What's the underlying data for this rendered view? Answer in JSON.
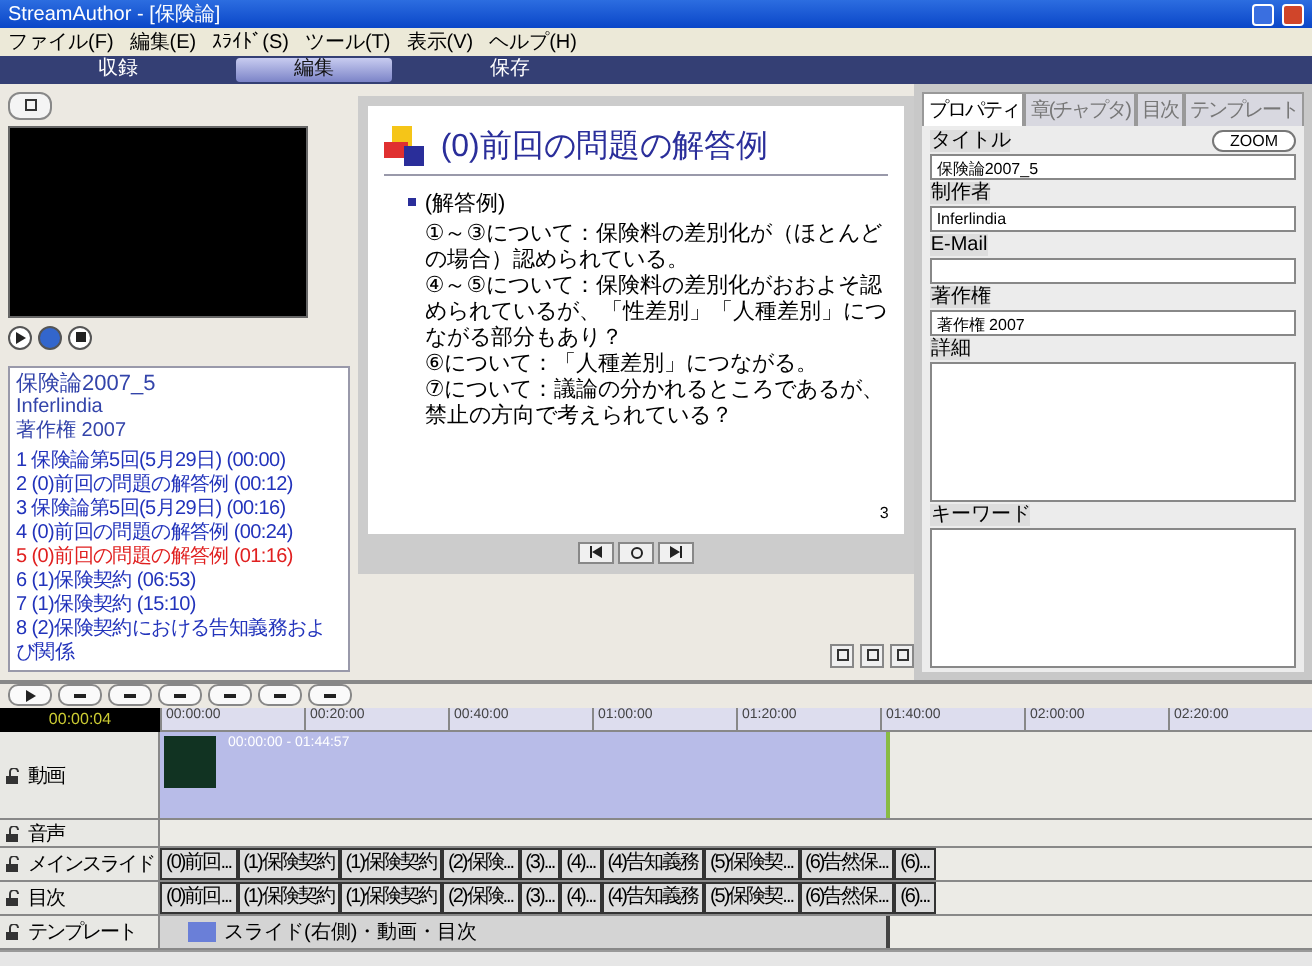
{
  "window": {
    "title": "StreamAuthor - [保険論]"
  },
  "menu": [
    "ファイル(F)",
    "編集(E)",
    "ｽﾗｲﾄﾞ(S)",
    "ツール(T)",
    "表示(V)",
    "ヘルプ(H)"
  ],
  "modes": [
    {
      "label": "収録",
      "selected": false
    },
    {
      "label": "編集",
      "selected": true
    },
    {
      "label": "保存",
      "selected": false
    }
  ],
  "contents": {
    "title": "保険論2007_5",
    "author": "Inferlindia",
    "copyright": "著作権 2007",
    "items": [
      {
        "label": "1 保険論第5回(5月29日) (00:00)",
        "selected": false
      },
      {
        "label": "2 (0)前回の問題の解答例 (00:12)",
        "selected": false
      },
      {
        "label": "3 保険論第5回(5月29日) (00:16)",
        "selected": false
      },
      {
        "label": "4 (0)前回の問題の解答例 (00:24)",
        "selected": false
      },
      {
        "label": "5 (0)前回の問題の解答例 (01:16)",
        "selected": true
      },
      {
        "label": "6 (1)保険契約 (06:53)",
        "selected": false
      },
      {
        "label": "7 (1)保険契約 (15:10)",
        "selected": false
      },
      {
        "label": "8 (2)保険契約における告知義務および関係",
        "selected": false
      }
    ]
  },
  "slide": {
    "title": "(0)前回の問題の解答例",
    "bullet": "(解答例)",
    "lines": [
      "①～③について：保険料の差別化が（ほとんどの場合）認められている。",
      "④～⑤について：保険料の差別化がおおよそ認められているが、「性差別」「人種差別」につながる部分もあり？",
      "⑥について：「人種差別」につながる。",
      "⑦について：議論の分かれるところであるが、禁止の方向で考えられている？"
    ],
    "page": "3"
  },
  "properties": {
    "tabs": [
      {
        "label": "プロパティ",
        "selected": true
      },
      {
        "label": "章(チャプタ)",
        "selected": false
      },
      {
        "label": "目次",
        "selected": false
      },
      {
        "label": "テンプレート",
        "selected": false
      }
    ],
    "zoom": "ZOOM",
    "fields": [
      {
        "label": "タイトル",
        "value": "保険論2007_5",
        "kind": "line"
      },
      {
        "label": "制作者",
        "value": "Inferlindia",
        "kind": "line"
      },
      {
        "label": "E-Mail",
        "kind": "line"
      },
      {
        "label": "著作権",
        "value": "著作権 2007",
        "kind": "line"
      },
      {
        "label": "詳細",
        "kind": "area"
      },
      {
        "label": "キーワード",
        "kind": "area"
      }
    ]
  },
  "timeline": {
    "time": "00:00:04",
    "ticks": [
      "00:00:00",
      "00:20:00",
      "00:40:00",
      "01:00:00",
      "01:20:00",
      "01:40:00",
      "02:00:00",
      "02:20:00"
    ],
    "tracks": [
      {
        "name": "動画",
        "kind": "video",
        "clip": "00:00:00 - 01:44:57"
      },
      {
        "name": "音声",
        "kind": "audio"
      },
      {
        "name": "メインスライド",
        "kind": "slides",
        "cells": [
          "(0)前回...",
          "(1)保険契約",
          "(1)保険契約",
          "(2)保険...",
          "(3)...",
          "(4)...",
          "(4)告知義務",
          "(5)保険契...",
          "(6)告然保...",
          "(6)..."
        ]
      },
      {
        "name": "目次",
        "kind": "slides",
        "cells": [
          "(0)前回...",
          "(1)保険契約",
          "(1)保険契約",
          "(2)保険...",
          "(3)...",
          "(4)...",
          "(4)告知義務",
          "(5)保険契...",
          "(6)告然保...",
          "(6)..."
        ]
      },
      {
        "name": "テンプレート",
        "kind": "template",
        "clip": "スライド(右側)・動画・目次"
      }
    ]
  }
}
